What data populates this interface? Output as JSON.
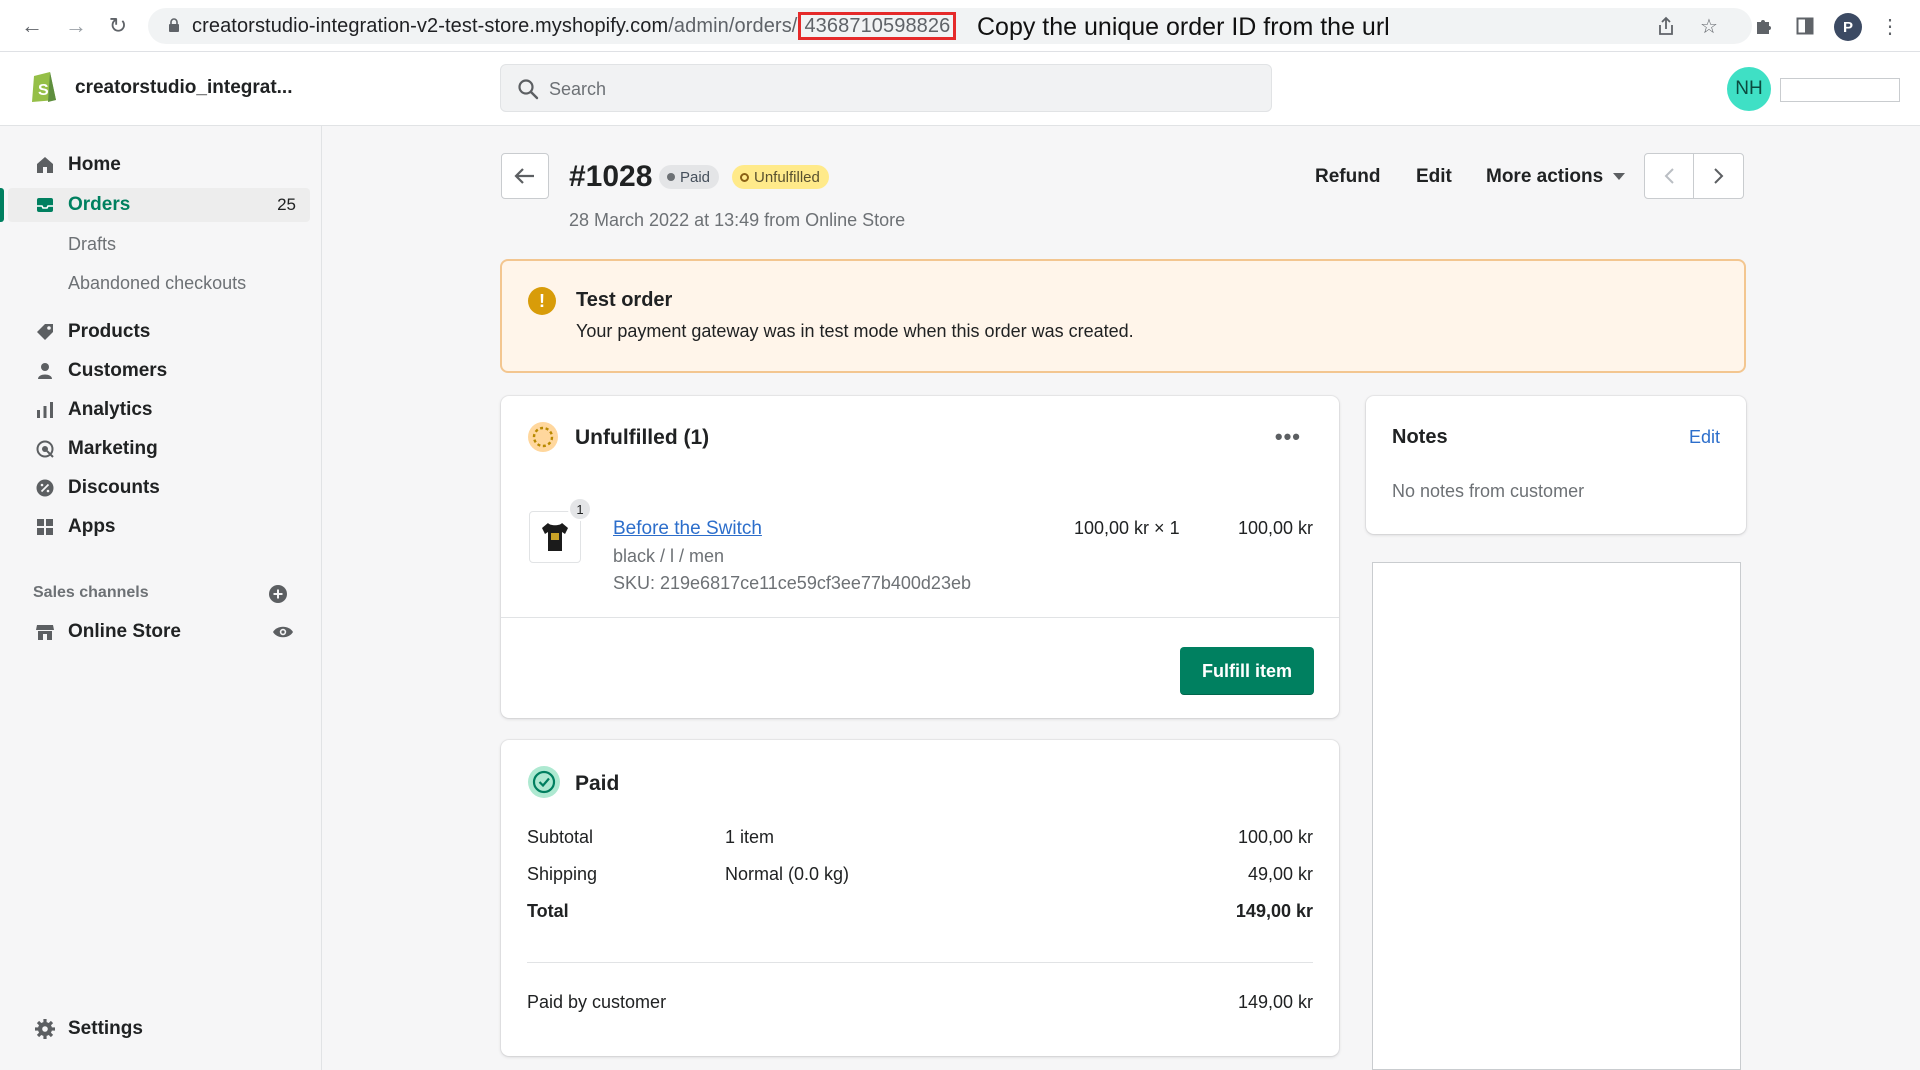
{
  "browser": {
    "url_prefix": "creatorstudio-integration-v2-test-store.myshopify.com",
    "url_path": "/admin/orders/",
    "url_order_id": "4368710598826",
    "annotation": "Copy the unique order ID from the url",
    "profile_initial": "P"
  },
  "topbar": {
    "store_name": "creatorstudio_integrat...",
    "search_placeholder": "Search",
    "user_initials": "NH"
  },
  "sidebar": {
    "home": "Home",
    "orders": "Orders",
    "orders_count": "25",
    "drafts": "Drafts",
    "abandoned": "Abandoned checkouts",
    "products": "Products",
    "customers": "Customers",
    "analytics": "Analytics",
    "marketing": "Marketing",
    "discounts": "Discounts",
    "apps": "Apps",
    "sales_channels": "Sales channels",
    "online_store": "Online Store",
    "settings": "Settings"
  },
  "order": {
    "number": "#1028",
    "payment_status": "Paid",
    "fulfillment_status": "Unfulfilled",
    "date": "28 March 2022 at 13:49 from Online Store",
    "actions": {
      "refund": "Refund",
      "edit": "Edit",
      "more": "More actions"
    }
  },
  "banner": {
    "title": "Test order",
    "text": "Your payment gateway was in test mode when this order was created."
  },
  "unfulfilled": {
    "title": "Unfulfilled (1)",
    "quantity": "1",
    "product_title": "Before the Switch",
    "variant": "black / l / men",
    "sku": "SKU: 219e6817ce11ce59cf3ee77b400d23eb",
    "price_qty": "100,00 kr × 1",
    "line_total": "100,00 kr",
    "fulfill_label": "Fulfill item"
  },
  "payment": {
    "title": "Paid",
    "subtotal_label": "Subtotal",
    "subtotal_detail": "1 item",
    "subtotal_value": "100,00 kr",
    "shipping_label": "Shipping",
    "shipping_detail": "Normal (0.0 kg)",
    "shipping_value": "49,00 kr",
    "total_label": "Total",
    "total_value": "149,00 kr",
    "paid_by_label": "Paid by customer",
    "paid_by_value": "149,00 kr"
  },
  "notes": {
    "title": "Notes",
    "edit": "Edit",
    "empty": "No notes from customer"
  },
  "colors": {
    "brand_green": "#008060",
    "link_blue": "#2c6ecb",
    "warning_bg": "#fff5ea",
    "unfulfilled_badge": "#ffea8a",
    "highlight_red": "#e52a2a"
  }
}
